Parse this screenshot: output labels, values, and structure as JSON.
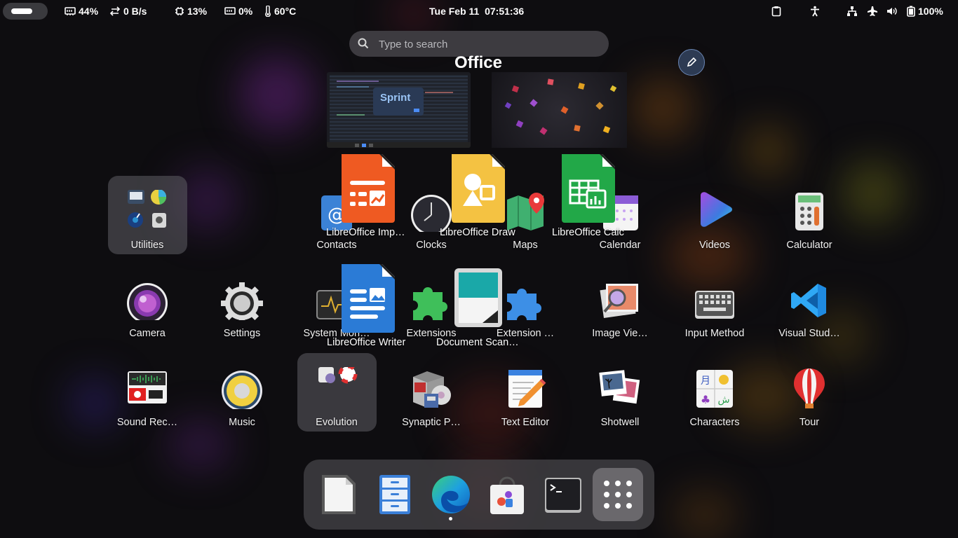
{
  "topbar": {
    "memory": "44%",
    "network": "0 B/s",
    "cpu": "13%",
    "gpu": "0%",
    "temperature": "60°C",
    "clock": "Tue Feb 11  07:51:36",
    "battery": "100%"
  },
  "search": {
    "placeholder": "Type to search"
  },
  "folder": {
    "title": "Office",
    "apps": [
      "LibreOffice Imp…",
      "LibreOffice Draw",
      "LibreOffice Calc",
      "LibreOffice Writer",
      "Document Scan…"
    ]
  },
  "grid": {
    "row1": [
      "Utilities",
      "Contacts",
      "Clocks",
      "Maps",
      "Calendar",
      "Videos",
      "Calculator"
    ],
    "row2": [
      "Camera",
      "Settings",
      "System Mon…",
      "Extensions",
      "Extension …",
      "Image Vie…",
      "Input Method",
      "Visual Stud…"
    ],
    "row3": [
      "Sound Rec…",
      "Music",
      "Evolution",
      "Synaptic P…",
      "Text Editor",
      "Shotwell",
      "Characters",
      "Tour"
    ]
  },
  "workspaces": {
    "thumb1_text": "Sprint"
  },
  "dock": [
    "LibreOffice",
    "Files",
    "Microsoft Edge",
    "Software",
    "Terminal",
    "Show Apps"
  ]
}
